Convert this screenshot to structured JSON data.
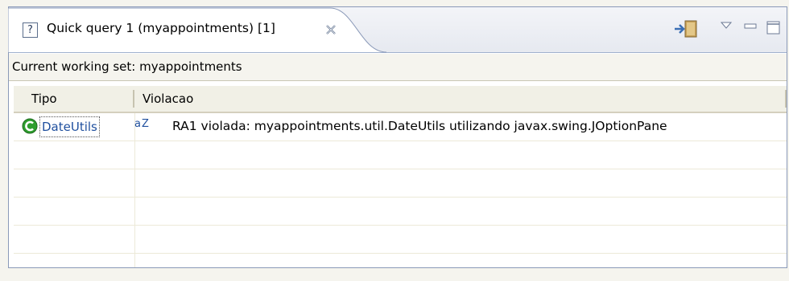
{
  "tab": {
    "title": "Quick query 1 (myappointments) [1]",
    "help_icon": "help-icon",
    "close_icon": "close-icon"
  },
  "toolbar": {
    "icons": [
      "connect-icon",
      "view-menu-icon",
      "minimize-icon",
      "maximize-icon"
    ]
  },
  "status": {
    "text": "Current working set: myappointments"
  },
  "table": {
    "columns": [
      "Tipo",
      "Violacao"
    ],
    "rows": [
      {
        "tipo": "DateUtils",
        "tipo_icon": "class-icon",
        "violacao_icon": "az-sort-icon",
        "violacao_icon_text": "aZ",
        "violacao": "RA1 violada: myappointments.util.DateUtils utilizando javax.swing.JOptionPane"
      }
    ]
  },
  "colors": {
    "view_border": "#8a99b8",
    "link_blue": "#1f4f9e",
    "class_icon_green": "#2f9e2f",
    "panel_bg": "#f5f4ee"
  }
}
